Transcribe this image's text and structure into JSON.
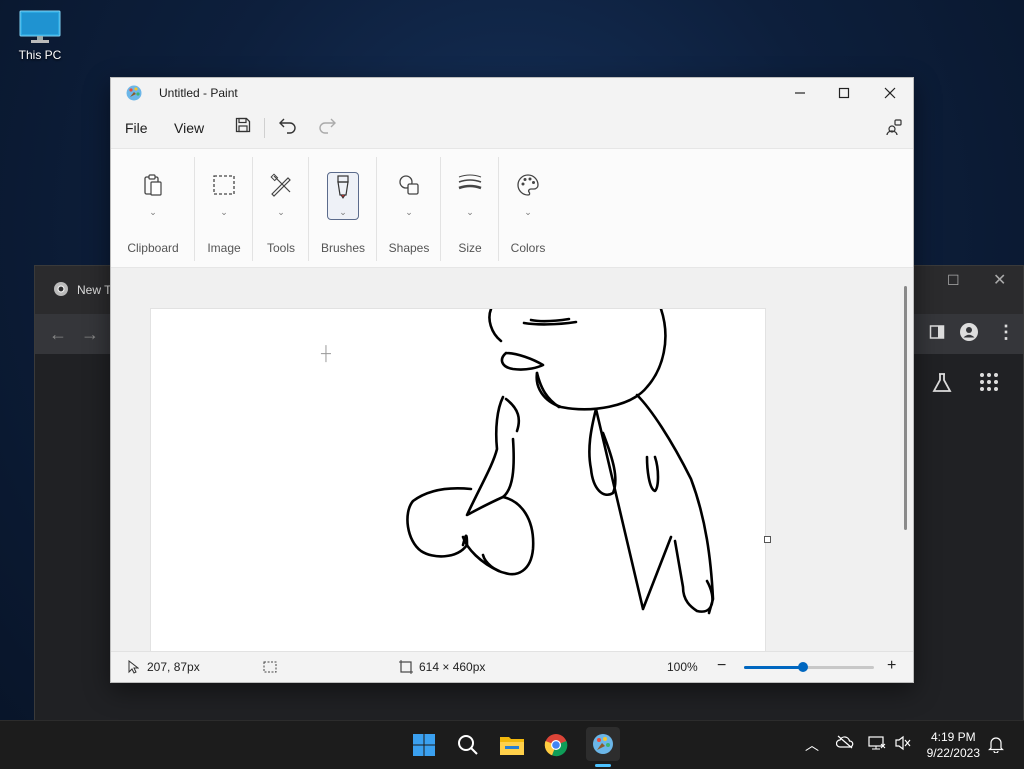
{
  "desktop": {
    "icon_label": "This PC"
  },
  "browser": {
    "tab_label": "New T"
  },
  "paint": {
    "title": "Untitled - Paint",
    "menu": {
      "file": "File",
      "view": "View"
    },
    "ribbon": {
      "clipboard": "Clipboard",
      "image": "Image",
      "tools": "Tools",
      "brushes": "Brushes",
      "shapes": "Shapes",
      "size": "Size",
      "colors": "Colors"
    },
    "status": {
      "cursor_pos": "207, 87px",
      "canvas_size": "614 × 460px",
      "zoom": "100%",
      "zoom_level": 0.45
    }
  },
  "taskbar": {
    "time": "4:19 PM",
    "date": "9/22/2023"
  },
  "colors": {
    "accent": "#0067c0",
    "taskbar": "#1c1c1c"
  }
}
